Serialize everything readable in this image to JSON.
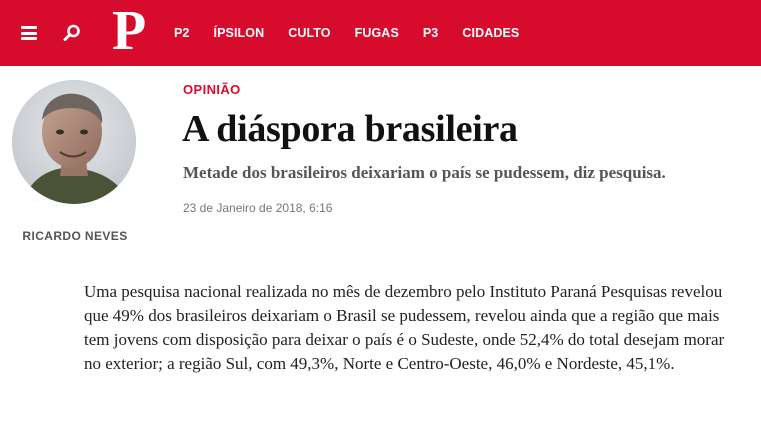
{
  "header": {
    "brand_color": "#d70b2b",
    "logo_text": "P",
    "menu_icon": "hamburger-menu-icon",
    "search_icon": "search-icon",
    "nav": [
      {
        "label": "P2"
      },
      {
        "label": "ÍPSILON"
      },
      {
        "label": "CULTO"
      },
      {
        "label": "FUGAS"
      },
      {
        "label": "P3"
      },
      {
        "label": "CIDADES"
      }
    ]
  },
  "author": {
    "name": "RICARDO NEVES"
  },
  "article": {
    "section": "OPINIÃO",
    "title": "A diáspora brasileira",
    "subtitle": "Metade dos brasileiros deixariam o país se pudessem, diz pesquisa.",
    "date": "23 de Janeiro de 2018, 6:16",
    "body": "Uma pesquisa nacional realizada no mês de dezembro pelo Instituto Paraná Pesquisas revelou que 49% dos brasileiros deixariam o Brasil se pudessem, revelou ainda que a região que mais tem jovens com disposição para deixar o país é o Sudeste, onde 52,4% do total desejam morar no exterior; a região Sul, com 49,3%, Norte e Centro-Oeste, 46,0% e Nordeste, 45,1%."
  }
}
